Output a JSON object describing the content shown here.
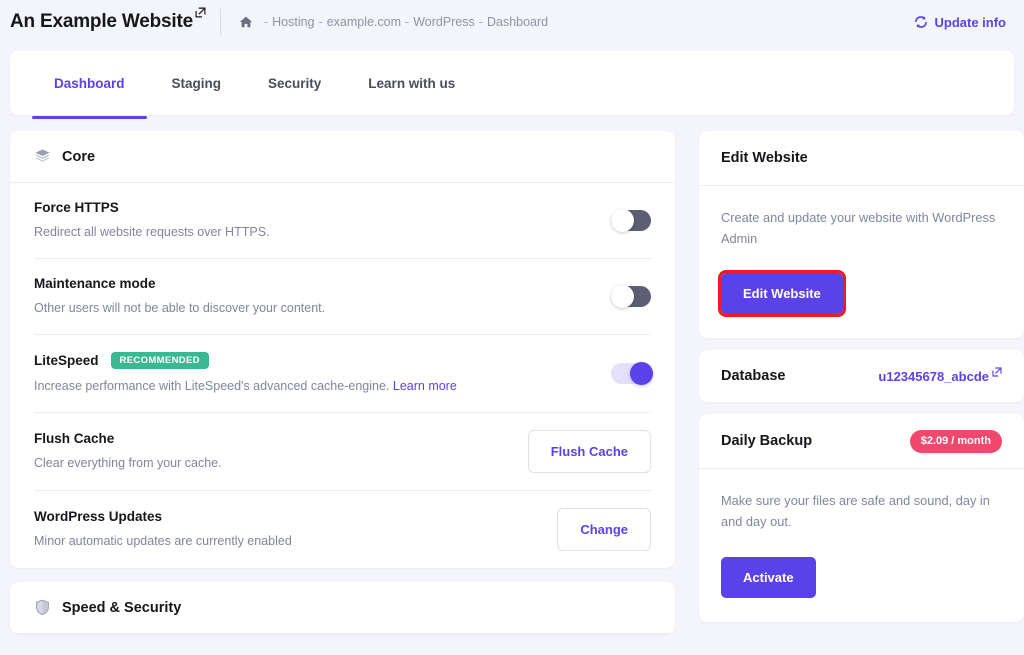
{
  "header": {
    "site_title": "An Example Website",
    "external_link_icon": "external-link-icon",
    "home_icon": "home-icon",
    "breadcrumb": [
      {
        "label": "Hosting"
      },
      {
        "label": "example.com"
      },
      {
        "label": "WordPress"
      },
      {
        "label": "Dashboard"
      }
    ],
    "breadcrumb_separator": "-",
    "update_info_label": "Update info",
    "update_info_icon": "refresh-icon"
  },
  "tabs": [
    {
      "label": "Dashboard",
      "active": true
    },
    {
      "label": "Staging",
      "active": false
    },
    {
      "label": "Security",
      "active": false
    },
    {
      "label": "Learn with us",
      "active": false
    }
  ],
  "core_card": {
    "icon": "layers-icon",
    "title": "Core",
    "rows": [
      {
        "title": "Force HTTPS",
        "desc": "Redirect all website requests over HTTPS.",
        "control": "toggle",
        "toggle_state": "off"
      },
      {
        "title": "Maintenance mode",
        "desc": "Other users will not be able to discover your content.",
        "control": "toggle",
        "toggle_state": "off"
      },
      {
        "title": "LiteSpeed",
        "badge": "RECOMMENDED",
        "desc": "Increase performance with LiteSpeed's advanced cache-engine.",
        "desc_link": "Learn more",
        "control": "toggle",
        "toggle_state": "on"
      },
      {
        "title": "Flush Cache",
        "desc": "Clear everything from your cache.",
        "control": "button",
        "button_label": "Flush Cache"
      },
      {
        "title": "WordPress Updates",
        "desc": "Minor automatic updates are currently enabled",
        "control": "button",
        "button_label": "Change"
      }
    ]
  },
  "speed_security_card": {
    "icon": "shield-icon",
    "title": "Speed & Security"
  },
  "edit_website_card": {
    "title": "Edit Website",
    "desc": "Create and update your website with WordPress Admin",
    "button_label": "Edit Website",
    "highlighted": true,
    "highlight_color": "#f41a1a"
  },
  "database_card": {
    "title": "Database",
    "value": "u12345678_abcde",
    "external_link_icon": "external-link-icon"
  },
  "daily_backup_card": {
    "title": "Daily Backup",
    "price_badge": "$2.09 / month",
    "desc": "Make sure your files are safe and sound, day in and day out.",
    "button_label": "Activate"
  },
  "colors": {
    "accent": "#5b42e8",
    "page_bg": "#f4f4fb",
    "badge_green": "#39b891",
    "badge_pink": "#ef4a6d",
    "toggle_off": "#5c5e72",
    "highlight_red": "#f41a1a"
  }
}
